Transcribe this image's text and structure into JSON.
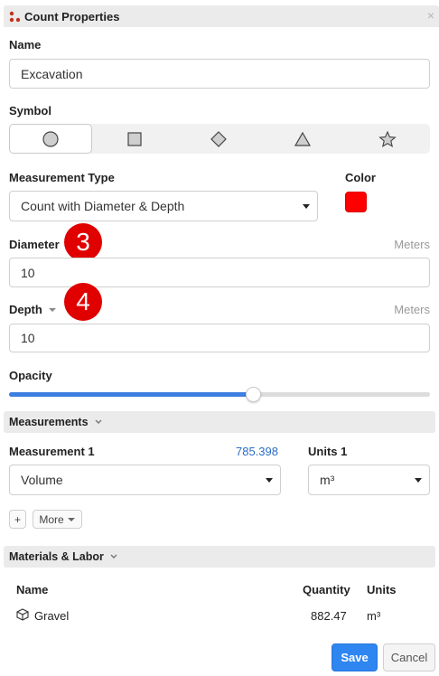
{
  "window": {
    "title": "Count Properties",
    "close_glyph": "×",
    "logo_icon": "count-dots-icon",
    "logo_color": "#c0321f"
  },
  "name_field": {
    "label": "Name",
    "value": "Excavation"
  },
  "symbol": {
    "label": "Symbol",
    "options": [
      "circle",
      "square",
      "diamond",
      "triangle",
      "star"
    ],
    "selected": "circle"
  },
  "measurement_type": {
    "label": "Measurement Type",
    "value": "Count with Diameter & Depth"
  },
  "color": {
    "label": "Color",
    "value": "#ff0000"
  },
  "diameter": {
    "label": "Diameter",
    "unit": "Meters",
    "value": "10",
    "badge": "3"
  },
  "depth": {
    "label": "Depth",
    "unit": "Meters",
    "value": "10",
    "badge": "4"
  },
  "opacity": {
    "label": "Opacity",
    "level_percent": 58
  },
  "measurements_section": {
    "title": "Measurements",
    "measurement_label": "Measurement 1",
    "measurement_value": "785.398",
    "units_label": "Units 1",
    "measurement_select": "Volume",
    "units_select": "m³",
    "add_label": "+",
    "more_label": "More"
  },
  "materials_section": {
    "title": "Materials & Labor",
    "columns": [
      "Name",
      "Quantity",
      "Units"
    ],
    "rows": [
      {
        "name": "Gravel",
        "quantity": "882.47",
        "units": "m³",
        "icon": "cube-icon"
      }
    ]
  },
  "footer": {
    "save_label": "Save",
    "cancel_label": "Cancel"
  },
  "colors": {
    "accent": "#2f86f0",
    "badge": "#e00000",
    "slider_fill": "#3d7ee0",
    "link": "#2b6cc4"
  }
}
